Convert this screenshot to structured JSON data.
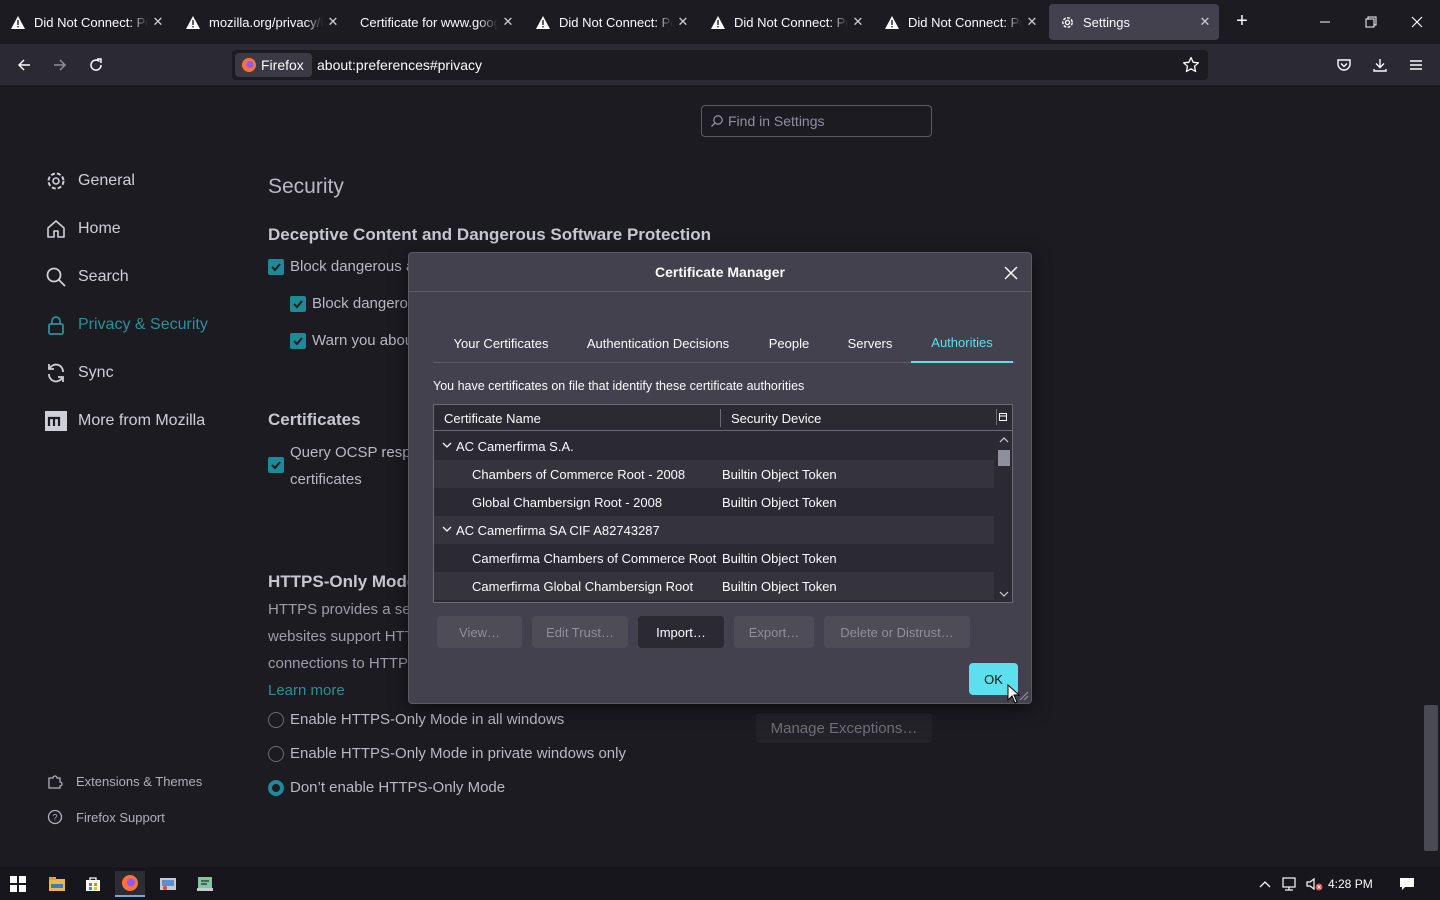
{
  "browser": {
    "tabs": [
      {
        "label": "Did Not Connect: Pote",
        "icon": "warning-icon"
      },
      {
        "label": "mozilla.org/privacy/fir",
        "icon": "warning-icon"
      },
      {
        "label": "Certificate for www.googl",
        "icon": "none"
      },
      {
        "label": "Did Not Connect: Pote",
        "icon": "warning-icon"
      },
      {
        "label": "Did Not Connect: Pote",
        "icon": "warning-icon"
      },
      {
        "label": "Did Not Connect: Pote",
        "icon": "warning-icon"
      },
      {
        "label": "Settings",
        "icon": "gear-icon"
      }
    ],
    "identity_label": "Firefox",
    "url": "about:preferences#privacy"
  },
  "settings": {
    "search_placeholder": "Find in Settings",
    "categories": [
      {
        "label": "General",
        "icon": "gear-icon"
      },
      {
        "label": "Home",
        "icon": "home-icon"
      },
      {
        "label": "Search",
        "icon": "search-icon"
      },
      {
        "label": "Privacy & Security",
        "icon": "lock-icon"
      },
      {
        "label": "Sync",
        "icon": "sync-icon"
      },
      {
        "label": "More from Mozilla",
        "icon": "mozilla-icon"
      }
    ],
    "footer_links": [
      {
        "label": "Extensions & Themes",
        "icon": "puzzle-icon"
      },
      {
        "label": "Firefox Support",
        "icon": "help-icon"
      }
    ],
    "security_heading": "Security",
    "deceptive_heading": "Deceptive Content and Dangerous Software Protection",
    "block_dangerous": "Block dangerous a",
    "block_dangerous_downloads": "Block dangero",
    "warn_unwanted": "Warn you abou",
    "certificates_heading": "Certificates",
    "ocsp_line1": "Query OCSP respo",
    "ocsp_line2": "certificates",
    "https_heading": "HTTPS-Only Mode",
    "https_desc": [
      "HTTPS provides a sec",
      "websites support HTT",
      "connections to HTTPS"
    ],
    "learn_more": "Learn more",
    "https_options": [
      "Enable HTTPS-Only Mode in all windows",
      "Enable HTTPS-Only Mode in private windows only",
      "Don’t enable HTTPS-Only Mode"
    ],
    "manage_exceptions": "Manage Exceptions…"
  },
  "dialog": {
    "title": "Certificate Manager",
    "tabs": [
      "Your Certificates",
      "Authentication Decisions",
      "People",
      "Servers",
      "Authorities"
    ],
    "active_tab": "Authorities",
    "intro": "You have certificates on file that identify these certificate authorities",
    "columns": {
      "name": "Certificate Name",
      "device": "Security Device"
    },
    "rows": [
      {
        "name": "AC Camerfirma S.A.",
        "device": "",
        "group": true
      },
      {
        "name": "Chambers of Commerce Root - 2008",
        "device": "Builtin Object Token",
        "group": false
      },
      {
        "name": "Global Chambersign Root - 2008",
        "device": "Builtin Object Token",
        "group": false
      },
      {
        "name": "AC Camerfirma SA CIF A82743287",
        "device": "",
        "group": true
      },
      {
        "name": "Camerfirma Chambers of Commerce Root",
        "device": "Builtin Object Token",
        "group": false
      },
      {
        "name": "Camerfirma Global Chambersign Root",
        "device": "Builtin Object Token",
        "group": false
      }
    ],
    "buttons": {
      "view": "View…",
      "edit_trust": "Edit Trust…",
      "import": "Import…",
      "export": "Export…",
      "delete": "Delete or Distrust…",
      "ok": "OK"
    }
  },
  "taskbar": {
    "clock": "4:28 PM"
  }
}
